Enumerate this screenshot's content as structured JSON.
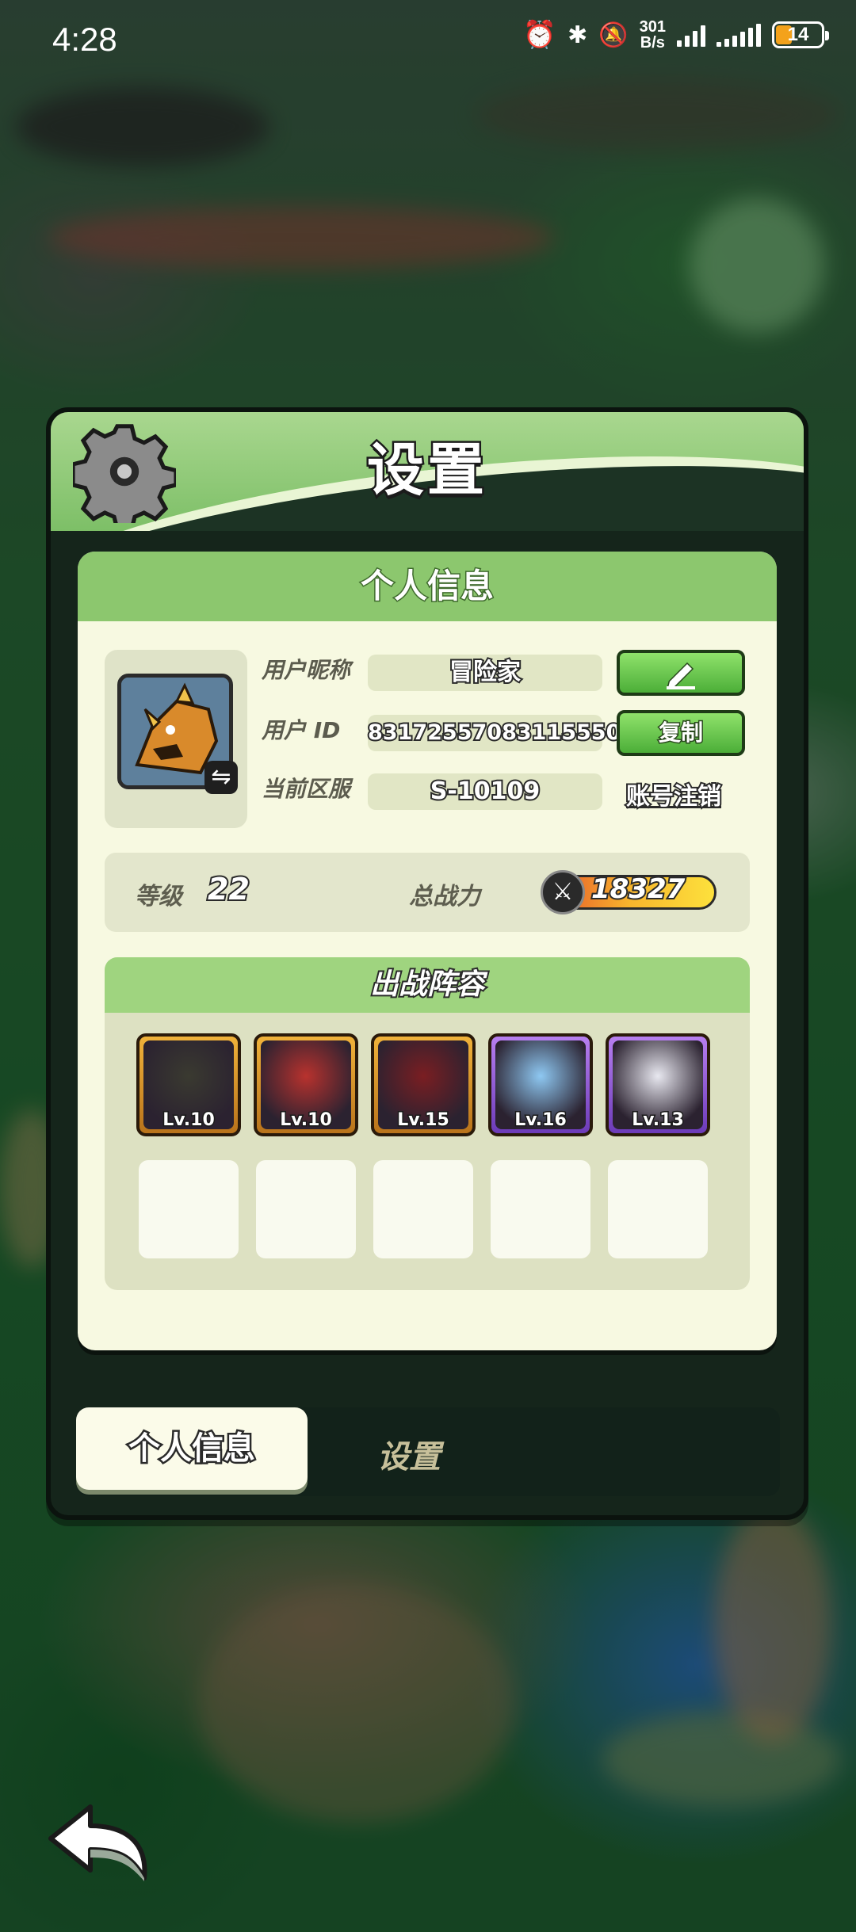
{
  "status_bar": {
    "time": "4:28",
    "net_speed_value": "301",
    "net_speed_unit": "B/s",
    "battery": "14"
  },
  "modal": {
    "title": "设置",
    "section_title": "个人信息",
    "profile": {
      "nickname_label": "用户昵称",
      "nickname_value": "冒险家",
      "user_id_label": "用户  ID",
      "user_id_value": "83172557083115550",
      "copy_label": "复制",
      "server_label": "当前区服",
      "server_value": "S-10109",
      "delete_account_label": "账号注销"
    },
    "stats": {
      "level_label": "等级",
      "level_value": "22",
      "power_label": "总战力",
      "power_value": "18327"
    },
    "lineup": {
      "title": "出战阵容",
      "heroes": [
        {
          "level": "Lv.10",
          "rarity": "gold"
        },
        {
          "level": "Lv.10",
          "rarity": "gold"
        },
        {
          "level": "Lv.15",
          "rarity": "gold"
        },
        {
          "level": "Lv.16",
          "rarity": "purple"
        },
        {
          "level": "Lv.13",
          "rarity": "purple"
        }
      ],
      "empty_slots": 5
    },
    "tabs": {
      "active": "个人信息",
      "other": "设置"
    }
  },
  "colors": {
    "accent_green": "#8cc76e",
    "button_green": "#4cae38",
    "card_bg": "#f7f9e1",
    "rarity_gold": "#f0b23a",
    "rarity_purple": "#b77ff0"
  }
}
